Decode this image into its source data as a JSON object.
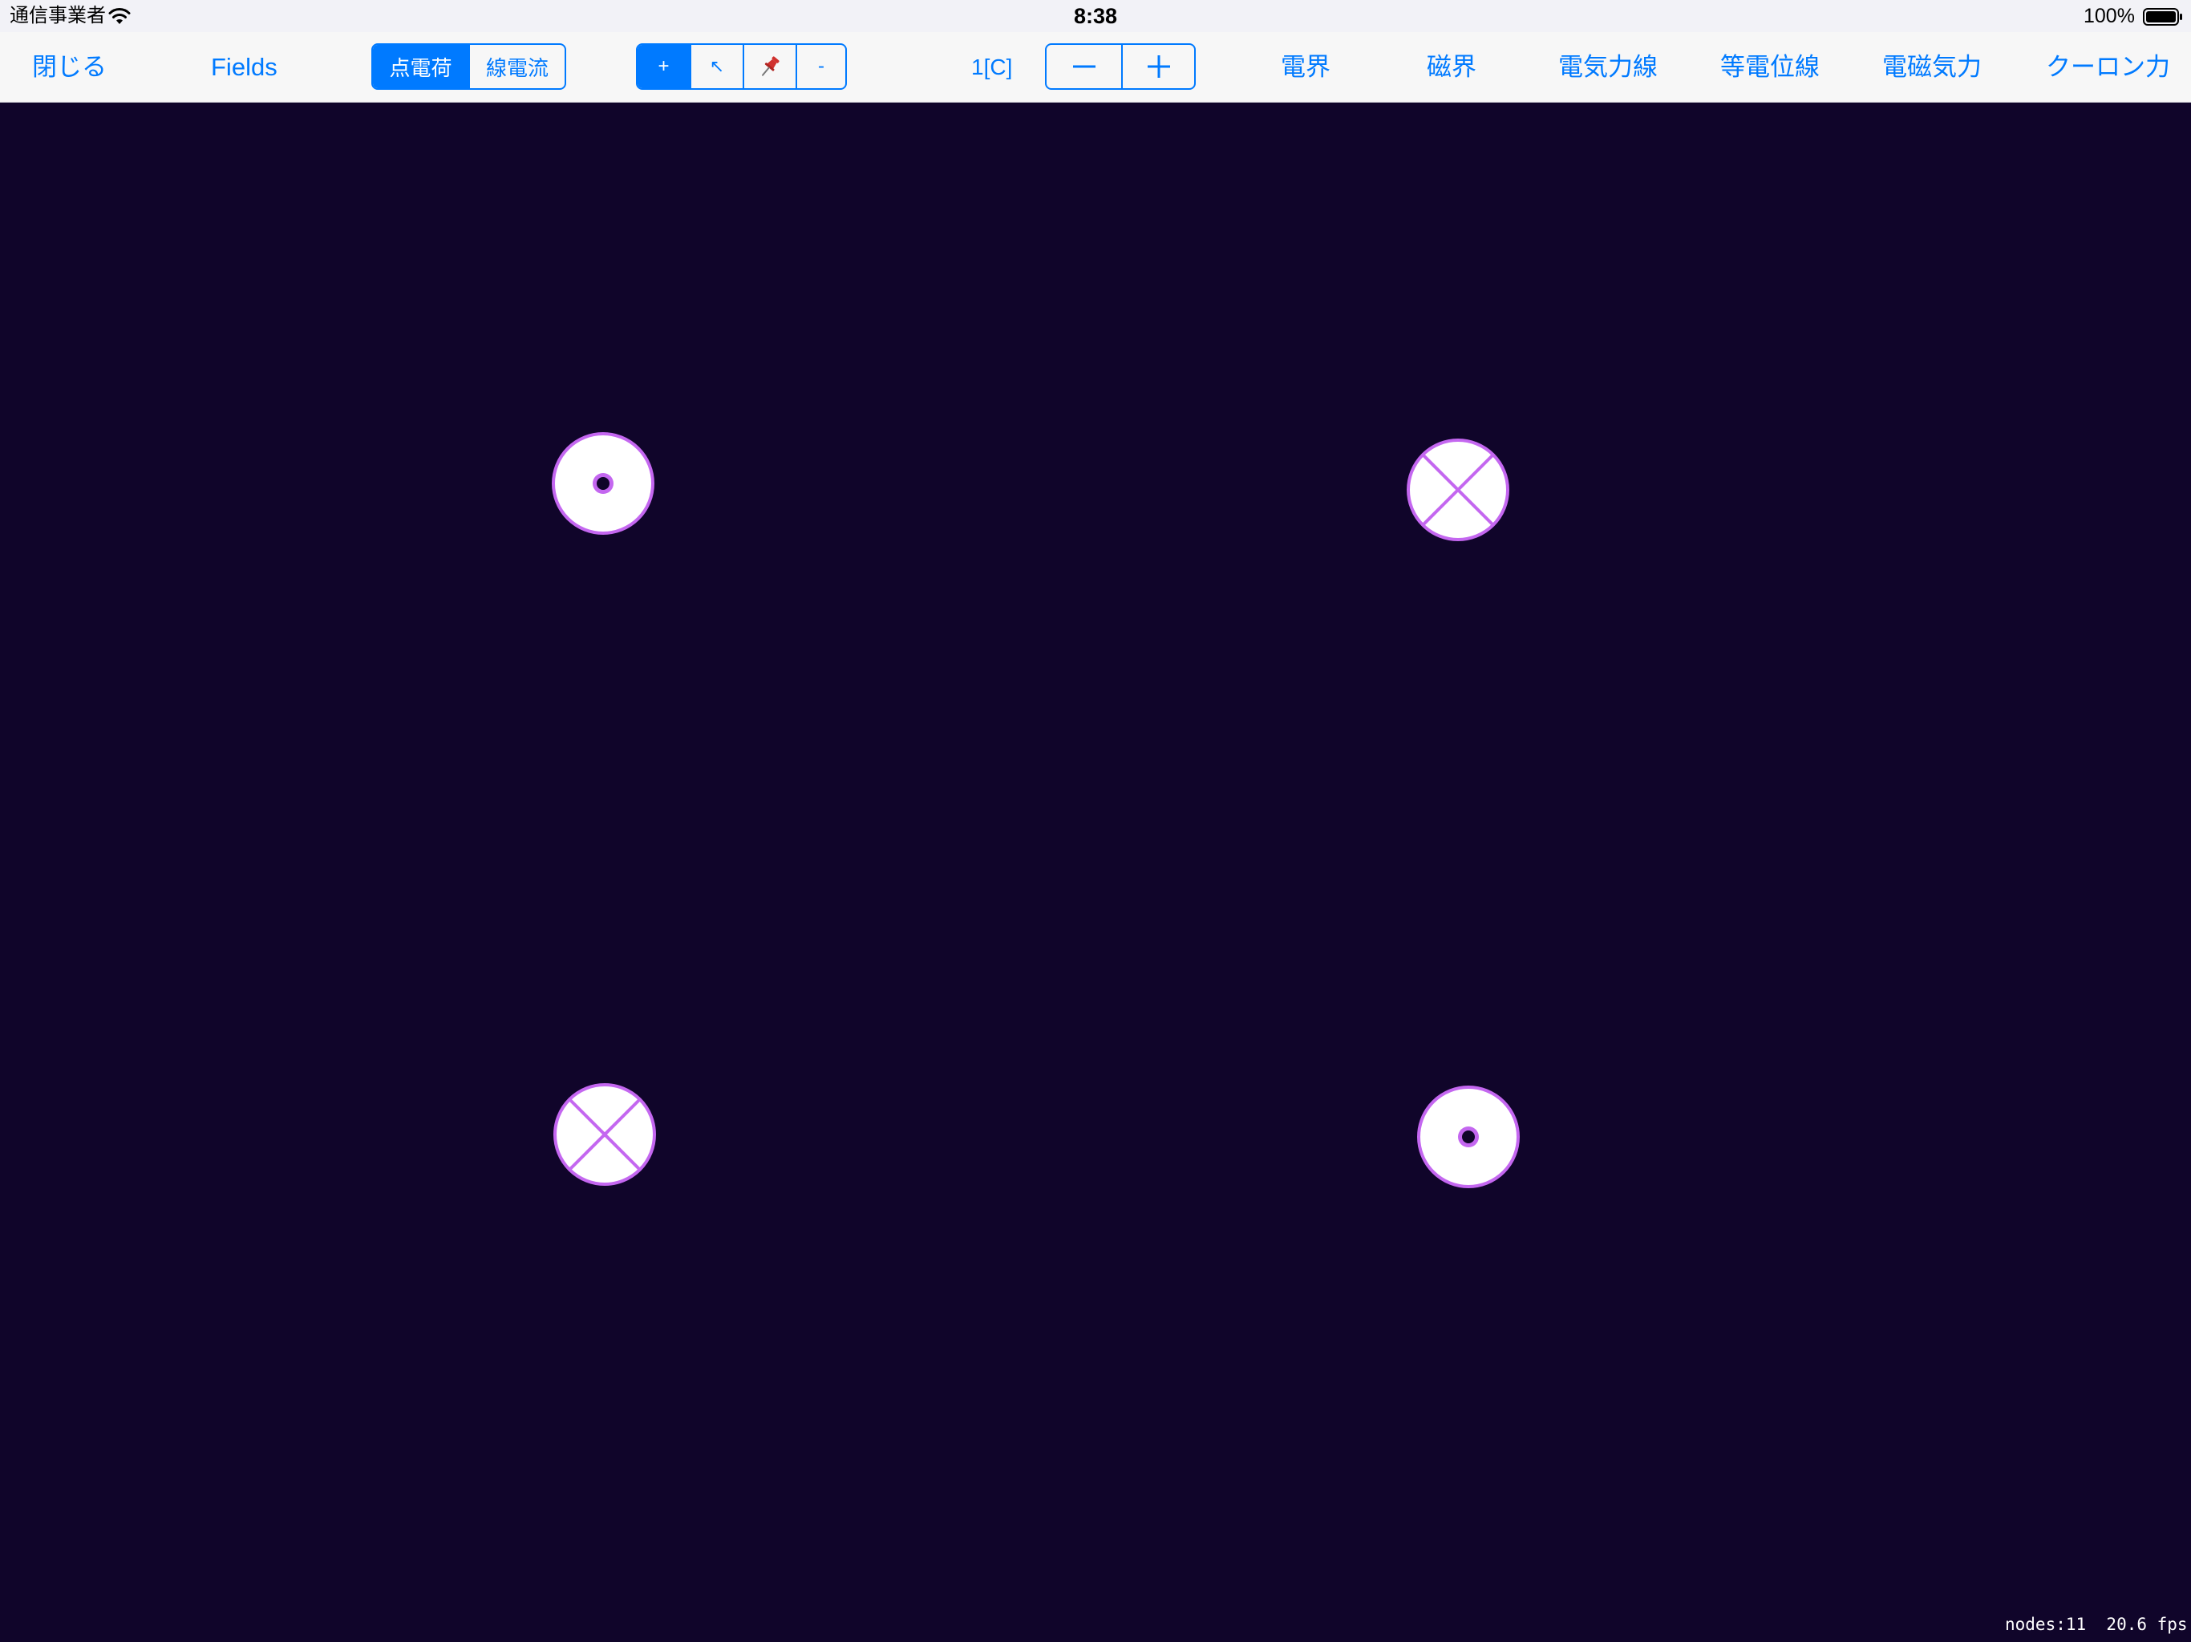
{
  "status_bar": {
    "carrier": "通信事業者",
    "time": "8:38",
    "battery_percent": "100%",
    "battery_level": 1.0,
    "wifi_icon": "wifi-icon",
    "battery_icon": "battery-icon"
  },
  "toolbar": {
    "close_label": "閉じる",
    "title": "Fields",
    "mode_segment": {
      "items": [
        "点電荷",
        "線電流"
      ],
      "selected": "点電荷"
    },
    "tool_segment": {
      "items": [
        "+",
        "↖",
        "pin-icon",
        "-"
      ],
      "selected": "+"
    },
    "charge_value": "1[C]",
    "stepper": {
      "decrement_icon": "minus-icon",
      "increment_icon": "plus-icon"
    },
    "options": [
      "電界",
      "磁界",
      "電気力線",
      "等電位線",
      "電磁気力",
      "クーロン力"
    ]
  },
  "canvas": {
    "background_color": "#10052a",
    "accent_color": "#c467f0",
    "charges": [
      {
        "type": "out-of-page",
        "icon": "dot-circle-icon"
      },
      {
        "type": "into-page",
        "icon": "cross-circle-icon"
      },
      {
        "type": "into-page",
        "icon": "cross-circle-icon"
      },
      {
        "type": "out-of-page",
        "icon": "dot-circle-icon"
      }
    ]
  },
  "stats": "nodes:11  20.6 fps",
  "colors": {
    "accent_blue": "#007aff",
    "toolbar_bg": "#f7f7f7",
    "pin_red": "#d0312d"
  }
}
